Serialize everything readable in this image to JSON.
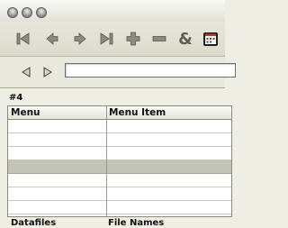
{
  "window": {
    "traffic_lights": [
      "close",
      "minimize",
      "zoom"
    ]
  },
  "toolbar": {
    "buttons": [
      {
        "icon": "first-record-icon"
      },
      {
        "icon": "previous-record-icon"
      },
      {
        "icon": "next-record-icon"
      },
      {
        "icon": "last-record-icon"
      },
      {
        "icon": "add-record-icon"
      },
      {
        "icon": "delete-record-icon"
      },
      {
        "icon": "ampersand-icon",
        "glyph": "&"
      },
      {
        "icon": "calendar-icon"
      }
    ]
  },
  "navigation": {
    "search_value": ""
  },
  "record": {
    "label": "#4"
  },
  "table": {
    "columns": [
      "Menu",
      "Menu Item"
    ],
    "rows": [
      [
        "",
        ""
      ],
      [
        "",
        ""
      ],
      [
        "",
        ""
      ],
      [
        "",
        ""
      ],
      [
        "",
        ""
      ],
      [
        "",
        ""
      ],
      [
        "",
        ""
      ],
      [
        "",
        ""
      ]
    ],
    "selected_row": 4
  },
  "footer": {
    "left_label": "Datafiles",
    "right_label": "File Names"
  },
  "colors": {
    "background": "#eeeee4",
    "selected_row": "#c4c4b6"
  }
}
